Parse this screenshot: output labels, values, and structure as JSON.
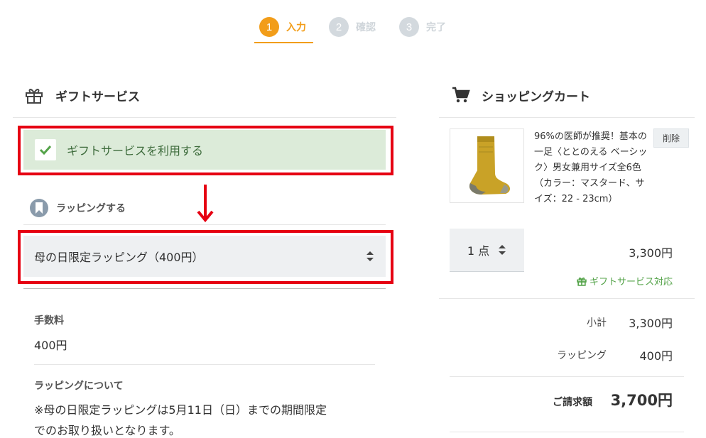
{
  "steps": [
    {
      "num": "1",
      "label": "入力"
    },
    {
      "num": "2",
      "label": "確認"
    },
    {
      "num": "3",
      "label": "完了"
    }
  ],
  "gift_section": {
    "title": "ギフトサービス",
    "use_gift_label": "ギフトサービスを利用する",
    "use_gift_checked": true,
    "wrapping_label": "ラッピングする",
    "wrapping_selected": "母の日限定ラッピング（400円）",
    "fee_label": "手数料",
    "fee_value": "400円",
    "about_label": "ラッピングについて",
    "about_text_1": "※母の日限定ラッピングは5月11日（日）までの期間限定",
    "about_text_2": "でのお取り扱いとなります。"
  },
  "cart": {
    "title": "ショッピングカート",
    "item": {
      "name": "96%の医師が推奨！基本の一足〈ととのえる ベーシック〉男女兼用サイズ全6色（カラー：マスタード、サイズ：22 - 23cm）",
      "delete_label": "削除",
      "quantity": "1 点",
      "price": "3,300円",
      "gift_ok": "ギフトサービス対応"
    },
    "subtotal_label": "小計",
    "subtotal_value": "3,300円",
    "wrapping_label": "ラッピング",
    "wrapping_value": "400円",
    "total_label": "ご請求額",
    "total_value": "3,700円"
  },
  "colors": {
    "accent": "#f29d19",
    "highlight": "#e60012",
    "gift_green": "#54a349"
  }
}
